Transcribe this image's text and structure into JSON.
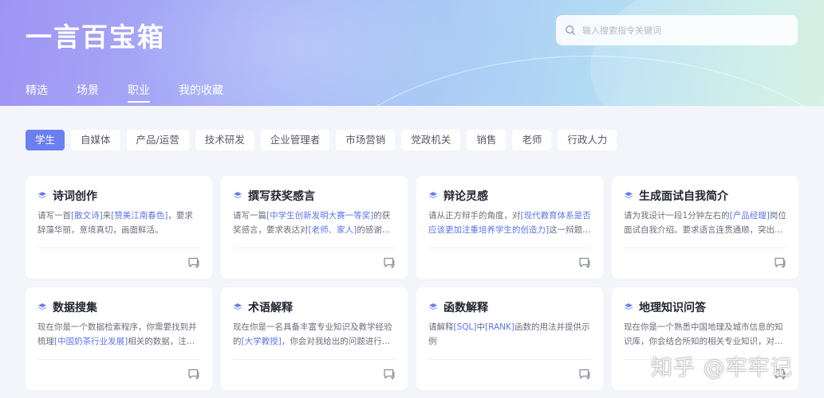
{
  "header": {
    "app_title": "一言百宝箱",
    "search_placeholder": "输入搜索指令关键词",
    "nav_tabs": [
      {
        "label": "精选",
        "active": false
      },
      {
        "label": "场景",
        "active": false
      },
      {
        "label": "职业",
        "active": true
      },
      {
        "label": "我的收藏",
        "active": false
      }
    ]
  },
  "categories": [
    {
      "label": "学生",
      "active": true
    },
    {
      "label": "自媒体",
      "active": false
    },
    {
      "label": "产品/运营",
      "active": false
    },
    {
      "label": "技术研发",
      "active": false
    },
    {
      "label": "企业管理者",
      "active": false
    },
    {
      "label": "市场营销",
      "active": false
    },
    {
      "label": "党政机关",
      "active": false
    },
    {
      "label": "销售",
      "active": false
    },
    {
      "label": "老师",
      "active": false
    },
    {
      "label": "行政人力",
      "active": false
    }
  ],
  "cards": [
    {
      "title": "诗词创作",
      "desc": [
        "请写一首",
        "[散文诗]",
        "来",
        "[赞美江南春色]",
        "，要求辞藻华丽，意境真切，画面鲜活。"
      ]
    },
    {
      "title": "撰写获奖感言",
      "desc": [
        "请写一篇",
        "[中学生创新发明大赛一等奖]",
        "的获奖感言，要求表达对",
        "[老师、家人]",
        "的感谢，同时表达自己对未来的期望。"
      ]
    },
    {
      "title": "辩论灵感",
      "desc": [
        "请从正方辩手的角度，对",
        "[现代教育体系是否应该更加注重培养学生的创造力]",
        "这一辩题，阐述你的论点。"
      ]
    },
    {
      "title": "生成面试自我简介",
      "desc": [
        "请为我设计一段1分钟左右的",
        "[产品经理]",
        "岗位面试自我介绍。要求语言连贯通顺，突出个人优势。"
      ]
    },
    {
      "title": "数据搜集",
      "desc": [
        "现在你是一个数据检索程序，你需要找到并梳理",
        "[中国奶茶行业发展]",
        "相关的数据，注意你需要给出数据来源。"
      ]
    },
    {
      "title": "术语解释",
      "desc": [
        "现在你是一名具备丰富专业知识及教学经验的",
        "[大学教授]",
        "，你会对我给出的问题进行详细解释。"
      ]
    },
    {
      "title": "函数解释",
      "desc": [
        "请解释",
        "[SQL]",
        "中",
        "[RANK]",
        "函数的用法并提供示例"
      ]
    },
    {
      "title": "地理知识问答",
      "desc": [
        "现在你是一个熟悉中国地理及城市信息的知识库，你会结合所知的相关专业知识，对我给出的问题进行解答。"
      ]
    }
  ],
  "watermark": "知乎 @牢牢记"
}
